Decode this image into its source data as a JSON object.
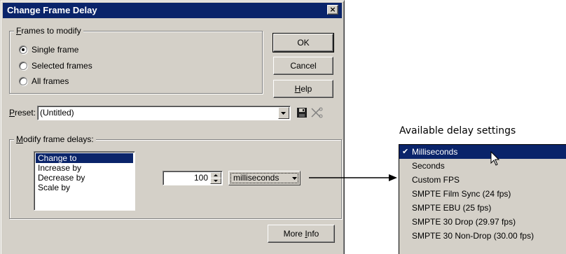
{
  "dialog": {
    "title": "Change Frame Delay",
    "close_glyph": "×",
    "frames_group": {
      "label": "Frames to modify",
      "accel": "F",
      "label_rest": "rames to modify",
      "options": [
        {
          "label": "Single frame",
          "checked": true
        },
        {
          "label": "Selected frames",
          "checked": false
        },
        {
          "label": "All frames",
          "checked": false
        }
      ]
    },
    "buttons": {
      "ok": "OK",
      "cancel": "Cancel",
      "help_accel": "H",
      "help_rest": "elp",
      "more_info_pre": "More ",
      "more_info_accel": "I",
      "more_info_rest": "nfo"
    },
    "preset": {
      "label_accel": "P",
      "label_rest": "reset:",
      "value": "(Untitled)"
    },
    "modify_group": {
      "label_accel": "M",
      "label_rest": "odify frame delays:",
      "list": [
        "Change to",
        "Increase by",
        "Decrease by",
        "Scale by"
      ],
      "selected": "Change to",
      "amount": "100",
      "unit": "milliseconds"
    }
  },
  "delay_settings": {
    "label": "Available delay settings",
    "options": [
      "Milliseconds",
      "Seconds",
      "Custom FPS",
      "SMPTE Film Sync (24 fps)",
      "SMPTE EBU (25 fps)",
      "SMPTE 30 Drop (29.97 fps)",
      "SMPTE 30 Non-Drop (30.00 fps)"
    ],
    "selected": "Milliseconds",
    "check_glyph": "✔"
  },
  "colors": {
    "title_bar": "#0a246a",
    "dialog_face": "#d4d0c8",
    "selection": "#0a246a"
  }
}
